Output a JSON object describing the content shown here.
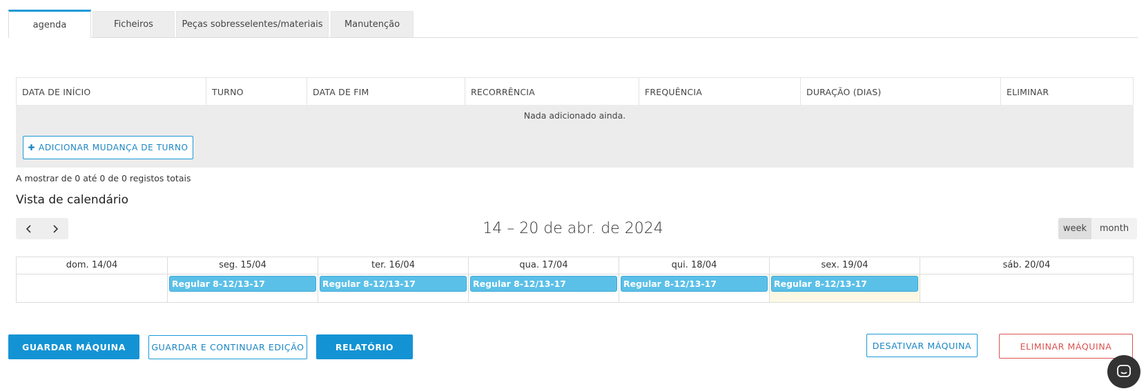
{
  "tabs": [
    {
      "label": "agenda",
      "active": true
    },
    {
      "label": "Ficheiros",
      "active": false
    },
    {
      "label": "Peças sobresselentes/materiais",
      "active": false
    },
    {
      "label": "Manutenção",
      "active": false
    }
  ],
  "shift_table": {
    "columns": [
      "DATA DE INÍCIO",
      "TURNO",
      "DATA DE FIM",
      "RECORRÊNCIA",
      "FREQUÊNCIA",
      "DURAÇÃO (DIAS)",
      "ELIMINAR"
    ],
    "empty_message": "Nada adicionado ainda.",
    "add_button": "ADICIONAR MUDANÇA DE TURNO",
    "records_summary": "A mostrar de 0 até 0 de 0 registos totais"
  },
  "calendar": {
    "title": "Vista de calendário",
    "range_label": "14 – 20 de abr. de 2024",
    "views": [
      {
        "label": "week",
        "active": true
      },
      {
        "label": "month",
        "active": false
      }
    ],
    "days": [
      {
        "label": "dom. 14/04",
        "event": "",
        "today": false
      },
      {
        "label": "seg. 15/04",
        "event": "Regular 8-12/13-17",
        "today": false
      },
      {
        "label": "ter. 16/04",
        "event": "Regular 8-12/13-17",
        "today": false
      },
      {
        "label": "qua. 17/04",
        "event": "Regular 8-12/13-17",
        "today": false
      },
      {
        "label": "qui. 18/04",
        "event": "Regular 8-12/13-17",
        "today": false
      },
      {
        "label": "sex. 19/04",
        "event": "Regular 8-12/13-17",
        "today": true
      },
      {
        "label": "sáb. 20/04",
        "event": "",
        "today": false
      }
    ]
  },
  "actions": {
    "save": "GUARDAR MÁQUINA",
    "save_continue": "GUARDAR E CONTINUAR EDIÇÃO",
    "report": "RELATÓRIO",
    "deactivate": "DESATIVAR MÁQUINA",
    "delete": "ELIMINAR MÁQUINA"
  },
  "icons": {
    "prev": "chevron-left-icon",
    "next": "chevron-right-icon",
    "add": "plus-icon",
    "chat": "chat-icon"
  },
  "colors": {
    "accent": "#1493d4",
    "event": "#5bc0e8",
    "danger": "#d9534f",
    "today": "#fcf8e3"
  }
}
